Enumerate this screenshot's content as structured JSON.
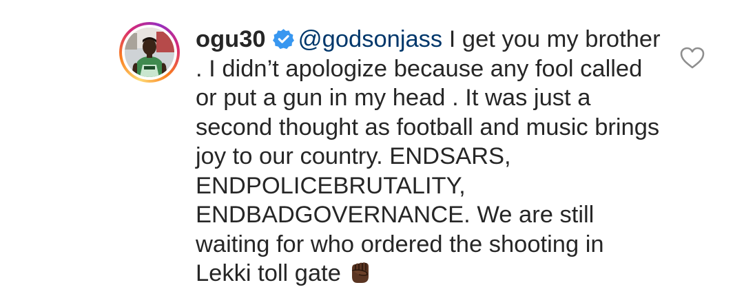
{
  "comment": {
    "username": "ogu30",
    "verified": true,
    "mention": "@godsonjass",
    "text": " I get you my brother . I didn’t apologize because any fool called or put a gun in my head . It was just a second thought as football and music brings joy to our country. ENDSARS, ENDPOLICEBRUTALITY, ENDBADGOVERNANCE. We are still waiting for who ordered the shooting in Lekki toll gate",
    "emoji": "raised-fist-dark-skin"
  },
  "icons": {
    "avatar": "profile-avatar",
    "verified": "verified-badge-icon",
    "like": "heart-outline-icon"
  },
  "colors": {
    "text": "#262626",
    "mention": "#00376b",
    "verified_badge": "#3897f0",
    "like_outline": "#8e8e8e"
  }
}
